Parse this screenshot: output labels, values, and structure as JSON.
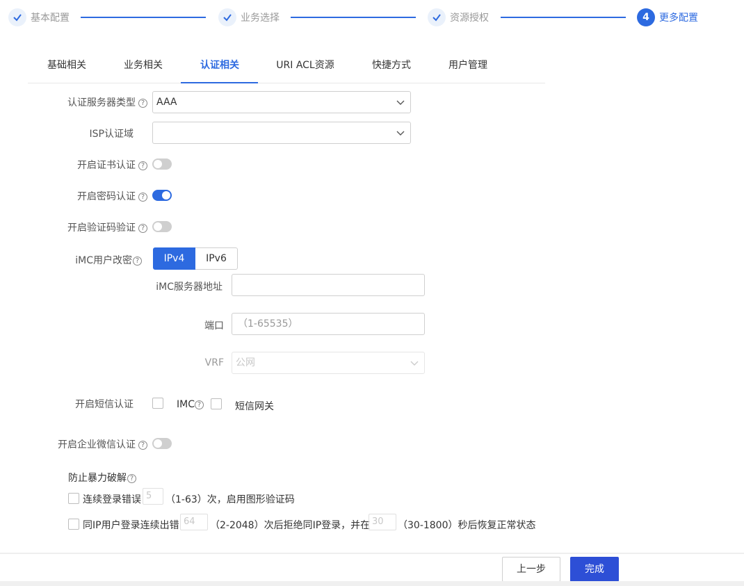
{
  "stepper": {
    "steps": [
      {
        "label": "基本配置",
        "state": "done"
      },
      {
        "label": "业务选择",
        "state": "done"
      },
      {
        "label": "资源授权",
        "state": "done"
      },
      {
        "label": "更多配置",
        "state": "active",
        "number": "4"
      }
    ]
  },
  "tabs": [
    {
      "label": "基础相关"
    },
    {
      "label": "业务相关"
    },
    {
      "label": "认证相关",
      "active": true
    },
    {
      "label": "URI ACL资源"
    },
    {
      "label": "快捷方式"
    },
    {
      "label": "用户管理"
    }
  ],
  "form": {
    "auth_server_type": {
      "label": "认证服务器类型",
      "help": "?",
      "value": "AAA"
    },
    "isp_domain": {
      "label": "ISP认证域",
      "value": ""
    },
    "cert_auth": {
      "label": "开启证书认证",
      "help": "?",
      "enabled": false
    },
    "password_auth": {
      "label": "开启密码认证",
      "help": "?",
      "enabled": true
    },
    "captcha_auth": {
      "label": "开启验证码验证",
      "help": "?",
      "enabled": false
    },
    "imc_change_pwd": {
      "label": "iMC用户改密",
      "help": "?",
      "options": [
        "IPv4",
        "IPv6"
      ],
      "selected": "IPv4",
      "server_addr_label": "iMC服务器地址",
      "server_addr_value": "",
      "port_label": "端口",
      "port_placeholder": "（1-65535）",
      "vrf_label": "VRF",
      "vrf_value": "公网"
    },
    "sms_auth": {
      "label": "开启短信认证",
      "imc_label": "IMC",
      "help": "?",
      "gateway_label": "短信网关"
    },
    "wechat_auth": {
      "label": "开启企业微信认证",
      "help": "?",
      "enabled": false
    },
    "brute_force": {
      "title": "防止暴力破解",
      "help": "?",
      "rule1": {
        "prefix": "连续登录错误",
        "value": "5",
        "suffix": "（1-63）次，启用图形验证码"
      },
      "rule2": {
        "prefix": "同IP用户登录连续出错",
        "value": "64",
        "middle": "（2-2048）次后拒绝同IP登录，并在",
        "value2": "30",
        "suffix": "（30-1800）秒后恢复正常状态"
      }
    }
  },
  "footer": {
    "prev_label": "上一步",
    "finish_label": "完成"
  },
  "colors": {
    "accent": "#2d6ae0",
    "primary_button": "#2d4fd6",
    "toggle_off": "#cfcfcf"
  }
}
